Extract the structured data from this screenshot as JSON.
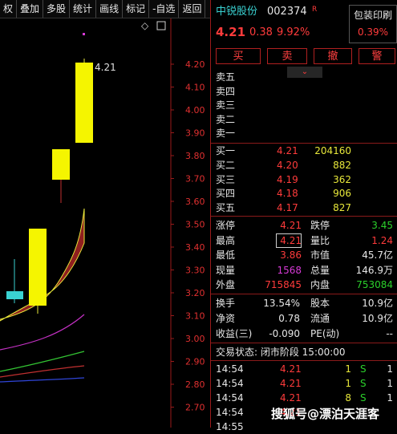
{
  "toolbar": [
    "权",
    "叠加",
    "多股",
    "统计",
    "画线",
    "标记",
    "-自选",
    "返回"
  ],
  "chart": {
    "price_label": "4.21",
    "ticks": [
      "4.20",
      "4.10",
      "4.00",
      "3.90",
      "3.80",
      "3.70",
      "3.60",
      "3.50",
      "3.40",
      "3.30",
      "3.20",
      "3.10",
      "3.00",
      "2.90",
      "2.80",
      "2.70"
    ]
  },
  "stock": {
    "name": "中锐股份",
    "code": "002374",
    "flag": "R",
    "price": "4.21",
    "change": "0.38",
    "pct": "9.92%",
    "box_title": "包装印刷",
    "box_pct": "0.39%"
  },
  "buttons": [
    "买",
    "卖",
    "撤",
    "警"
  ],
  "sell": [
    "卖五",
    "卖四",
    "卖三",
    "卖二",
    "卖一"
  ],
  "buy": [
    {
      "label": "买一",
      "price": "4.21",
      "vol": "204160"
    },
    {
      "label": "买二",
      "price": "4.20",
      "vol": "882"
    },
    {
      "label": "买三",
      "price": "4.19",
      "vol": "362"
    },
    {
      "label": "买四",
      "price": "4.18",
      "vol": "906"
    },
    {
      "label": "买五",
      "price": "4.17",
      "vol": "827"
    }
  ],
  "stats": [
    {
      "l1": "涨停",
      "v1": "4.21",
      "c1": "red",
      "l2": "跌停",
      "v2": "3.45",
      "c2": "grn"
    },
    {
      "l1": "最高",
      "v1": "4.21",
      "c1": "red",
      "l2": "量比",
      "v2": "1.24",
      "c2": "red"
    },
    {
      "l1": "最低",
      "v1": "3.86",
      "c1": "red",
      "l2": "市值",
      "v2": "45.7亿",
      "c2": "wht"
    },
    {
      "l1": "现量",
      "v1": "1568",
      "c1": "mag",
      "l2": "总量",
      "v2": "146.9万",
      "c2": "wht"
    },
    {
      "l1": "外盘",
      "v1": "715845",
      "c1": "red",
      "l2": "内盘",
      "v2": "753084",
      "c2": "grn"
    }
  ],
  "fin": [
    {
      "l1": "换手",
      "v1": "13.54%",
      "l2": "股本",
      "v2": "10.9亿"
    },
    {
      "l1": "净资",
      "v1": "0.78",
      "l2": "流通",
      "v2": "10.9亿"
    },
    {
      "l1": "收益(三)",
      "v1": "-0.090",
      "l2": "PE(动)",
      "v2": "--"
    }
  ],
  "status": "交易状态: 闭市阶段 15:00:00",
  "ticks_table": [
    {
      "time": "14:54",
      "price": "4.21",
      "vol": "1",
      "bs": "S",
      "n": "1"
    },
    {
      "time": "14:54",
      "price": "4.21",
      "vol": "1",
      "bs": "S",
      "n": "1"
    },
    {
      "time": "14:54",
      "price": "4.21",
      "vol": "8",
      "bs": "S",
      "n": "1"
    },
    {
      "time": "14:54",
      "price": "4.21",
      "vol": "",
      "bs": "",
      "n": ""
    },
    {
      "time": "14:55",
      "price": "",
      "vol": "",
      "bs": "",
      "n": ""
    }
  ],
  "watermark": "搜狐号@漂泊天涯客"
}
